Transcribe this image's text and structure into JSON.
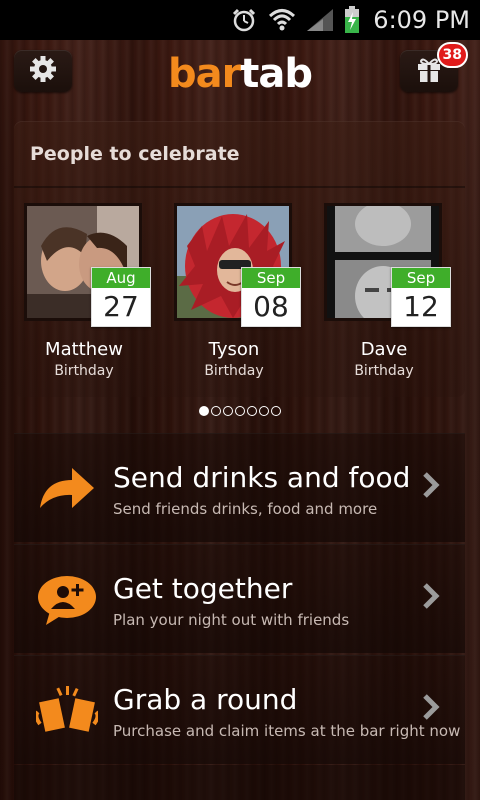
{
  "status_bar": {
    "time": "6:09 PM"
  },
  "header": {
    "logo_bar": "bar",
    "logo_tab": "tab",
    "gift_badge": "38"
  },
  "celebrate": {
    "title": "People to celebrate",
    "people": [
      {
        "name": "Matthew",
        "occasion": "Birthday",
        "month": "Aug",
        "day": "27"
      },
      {
        "name": "Tyson",
        "occasion": "Birthday",
        "month": "Sep",
        "day": "08"
      },
      {
        "name": "Dave",
        "occasion": "Birthday",
        "month": "Sep",
        "day": "12"
      }
    ]
  },
  "actions": [
    {
      "title": "Send drinks and food",
      "subtitle": "Send friends drinks, food and more",
      "icon": "arrow-icon"
    },
    {
      "title": "Get together",
      "subtitle": "Plan your night out with friends",
      "icon": "add-friend-icon"
    },
    {
      "title": "Grab a round",
      "subtitle": "Purchase and claim items at the bar right now",
      "icon": "beer-toast-icon"
    }
  ],
  "colors": {
    "accent": "#f38a1d",
    "calendar_green": "#3fae2a",
    "badge_red": "#e11b1b"
  }
}
